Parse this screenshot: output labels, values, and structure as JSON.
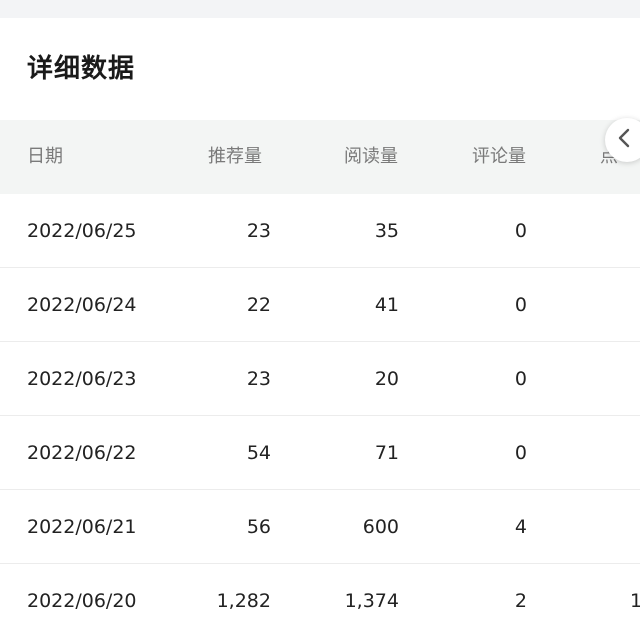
{
  "section": {
    "title": "详细数据"
  },
  "table": {
    "headers": {
      "date": "日期",
      "recommend": "推荐量",
      "read": "阅读量",
      "comment": "评论量",
      "more": "点"
    },
    "rows": [
      {
        "date": "2022/06/25",
        "recommend": "23",
        "read": "35",
        "comment": "0",
        "more": ""
      },
      {
        "date": "2022/06/24",
        "recommend": "22",
        "read": "41",
        "comment": "0",
        "more": ""
      },
      {
        "date": "2022/06/23",
        "recommend": "23",
        "read": "20",
        "comment": "0",
        "more": ""
      },
      {
        "date": "2022/06/22",
        "recommend": "54",
        "read": "71",
        "comment": "0",
        "more": ""
      },
      {
        "date": "2022/06/21",
        "recommend": "56",
        "read": "600",
        "comment": "4",
        "more": ""
      },
      {
        "date": "2022/06/20",
        "recommend": "1,282",
        "read": "1,374",
        "comment": "2",
        "more": "1"
      }
    ]
  },
  "scroll_button": {
    "icon": "chevron-left-icon"
  }
}
